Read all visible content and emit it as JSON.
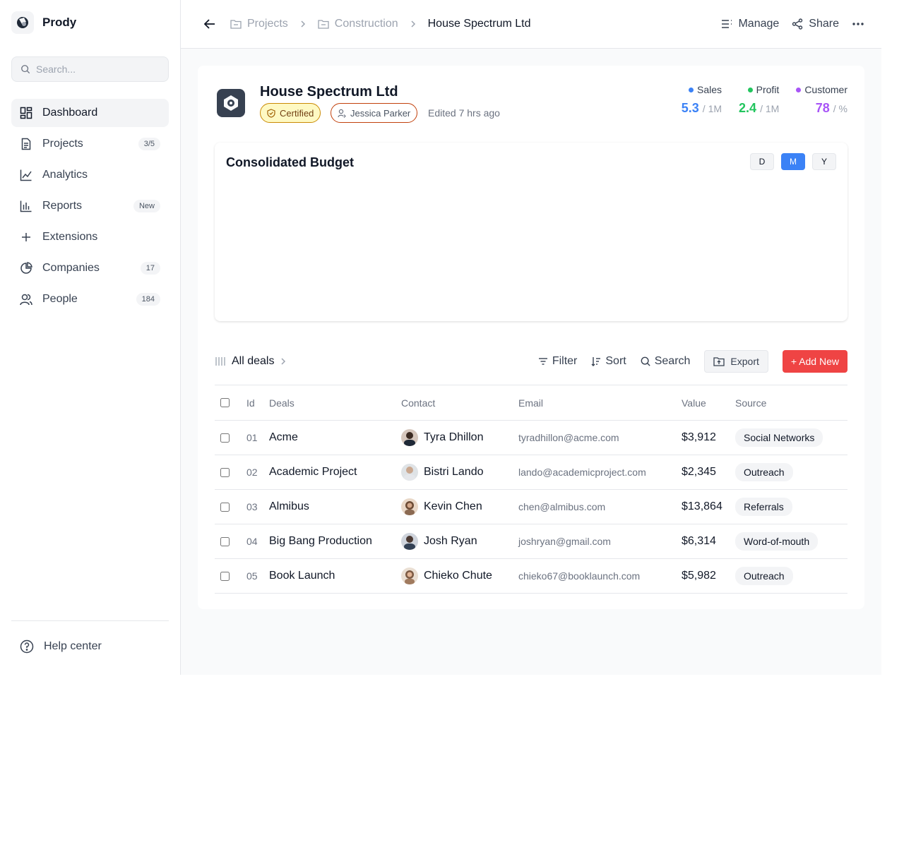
{
  "app": {
    "name": "Prody"
  },
  "sidebar": {
    "search_placeholder": "Search...",
    "items": [
      {
        "label": "Dashboard",
        "badge": "",
        "icon": "dashboard-icon"
      },
      {
        "label": "Projects",
        "badge": "3/5",
        "icon": "document-icon"
      },
      {
        "label": "Analytics",
        "badge": "",
        "icon": "line-chart-icon"
      },
      {
        "label": "Reports",
        "badge": "New",
        "icon": "bar-chart-icon"
      },
      {
        "label": "Extensions",
        "badge": "",
        "icon": "plus-icon"
      },
      {
        "label": "Companies",
        "badge": "17",
        "icon": "pie-chart-icon"
      },
      {
        "label": "People",
        "badge": "184",
        "icon": "people-icon"
      }
    ],
    "help_label": "Help center"
  },
  "topbar": {
    "breadcrumbs": [
      "Projects",
      "Construction",
      "House Spectrum Ltd"
    ],
    "manage_label": "Manage",
    "share_label": "Share"
  },
  "company": {
    "name": "House Spectrum Ltd",
    "certified_label": "Certified",
    "owner": "Jessica Parker",
    "edited": "Edited 7 hrs ago"
  },
  "stats": [
    {
      "label": "Sales",
      "value": "5.3",
      "unit": "/ 1M",
      "color": "#3b82f6"
    },
    {
      "label": "Profit",
      "value": "2.4",
      "unit": "/ 1M",
      "color": "#22c55e"
    },
    {
      "label": "Customer",
      "value": "78",
      "unit": "/ %",
      "color": "#a855f7"
    }
  ],
  "budget": {
    "title": "Consolidated Budget",
    "periods": [
      "D",
      "M",
      "Y"
    ],
    "active_period": "M"
  },
  "deals": {
    "title": "All deals",
    "filter_label": "Filter",
    "sort_label": "Sort",
    "search_label": "Search",
    "export_label": "Export",
    "add_label": "+ Add New",
    "add_color": "#ef4444",
    "columns": [
      "Id",
      "Deals",
      "Contact",
      "Email",
      "Value",
      "Source"
    ],
    "rows": [
      {
        "id": "01",
        "deal": "Acme",
        "contact": "Tyra Dhillon",
        "email": "tyradhillon@acme.com",
        "value": "$3,912",
        "source": "Social Networks"
      },
      {
        "id": "02",
        "deal": "Academic Project",
        "contact": "Bistri Lando",
        "email": "lando@academicproject.com",
        "value": "$2,345",
        "source": "Outreach"
      },
      {
        "id": "03",
        "deal": "Almibus",
        "contact": "Kevin Chen",
        "email": "chen@almibus.com",
        "value": "$13,864",
        "source": "Referrals"
      },
      {
        "id": "04",
        "deal": "Big Bang Production",
        "contact": "Josh Ryan",
        "email": "joshryan@gmail.com",
        "value": "$6,314",
        "source": "Word-of-mouth"
      },
      {
        "id": "05",
        "deal": "Book Launch",
        "contact": "Chieko Chute",
        "email": "chieko67@booklaunch.com",
        "value": "$5,982",
        "source": "Outreach"
      }
    ]
  }
}
